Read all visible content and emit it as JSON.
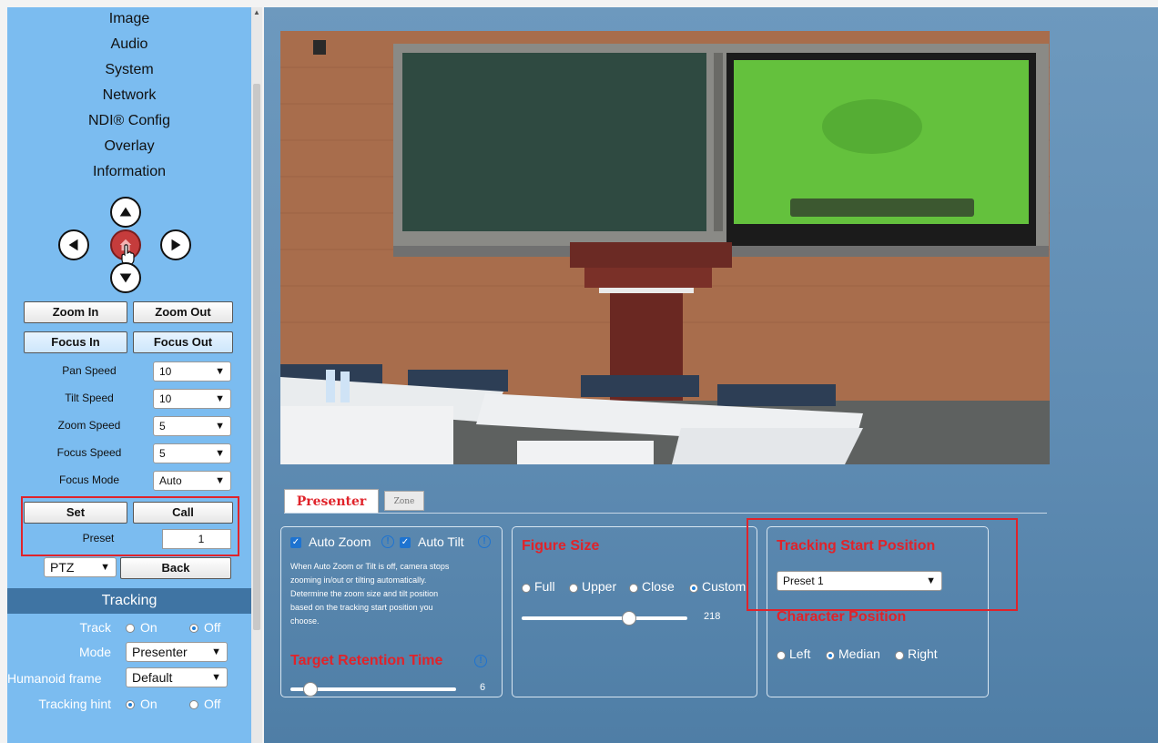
{
  "menu": [
    "Image",
    "Audio",
    "System",
    "Network",
    "NDI® Config",
    "Overlay",
    "Information"
  ],
  "ptz": {
    "zoom_in": "Zoom In",
    "zoom_out": "Zoom Out",
    "focus_in": "Focus In",
    "focus_out": "Focus Out",
    "speeds": [
      {
        "label": "Pan Speed",
        "value": "10"
      },
      {
        "label": "Tilt Speed",
        "value": "10"
      },
      {
        "label": "Zoom Speed",
        "value": "5"
      },
      {
        "label": "Focus Speed",
        "value": "5"
      },
      {
        "label": "Focus Mode",
        "value": "Auto"
      }
    ],
    "set": "Set",
    "call": "Call",
    "preset_label": "Preset",
    "preset_value": "1",
    "mode_select": "PTZ",
    "back": "Back"
  },
  "tracking": {
    "title": "Tracking",
    "track_label": "Track",
    "track_on": "On",
    "track_off": "Off",
    "track_value": "Off",
    "mode_label": "Mode",
    "mode_value": "Presenter",
    "frame_label": "Humanoid frame",
    "frame_value": "Default",
    "hint_label": "Tracking hint",
    "hint_on": "On",
    "hint_off": "Off",
    "hint_value": "On"
  },
  "tabs": {
    "presenter": "Presenter",
    "zone": "Zone"
  },
  "panel1": {
    "auto_zoom": "Auto Zoom",
    "auto_tilt": "Auto Tilt",
    "note_lines": [
      "When Auto Zoom or Tilt is off, camera stops",
      "zooming in/out or tilting automatically.",
      "Determine the zoom size and tilt position",
      "based on the tracking start position you",
      "choose."
    ],
    "retention_title": "Target Retention Time",
    "retention_value": "6",
    "retention_fraction": 0.12
  },
  "panel2": {
    "title": "Figure Size",
    "options": [
      "Full",
      "Upper",
      "Close",
      "Custom"
    ],
    "selected": "Custom",
    "slider_value": "218",
    "slider_fraction": 0.65
  },
  "panel3": {
    "start_title": "Tracking Start Position",
    "start_value": "Preset 1",
    "char_title": "Character Position",
    "options": [
      "Left",
      "Median",
      "Right"
    ],
    "selected": "Median"
  },
  "icons": [
    "arrow-up-icon",
    "arrow-left-icon",
    "home-icon",
    "arrow-right-icon",
    "arrow-down-icon",
    "chevron-down-icon",
    "info-icon",
    "checkbox-checked-icon",
    "hand-cursor-icon"
  ],
  "colors": {
    "sidebar": "#7bbcf0",
    "accent_red": "#e0232a",
    "tracking_bar": "#3f74a3"
  }
}
